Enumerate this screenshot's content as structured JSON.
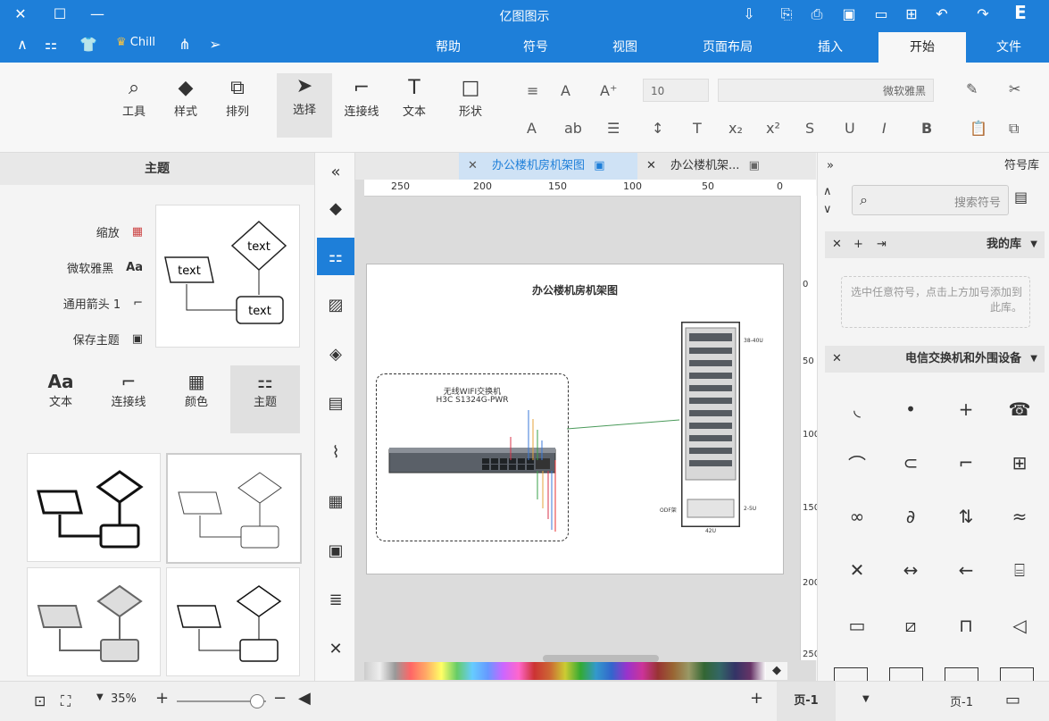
{
  "window": {
    "title": "亿图图示"
  },
  "menu_tabs": [
    "文件",
    "开始",
    "插入",
    "页面布局",
    "视图",
    "符号",
    "帮助"
  ],
  "active_tab": "开始",
  "user": {
    "name": "Chill"
  },
  "ribbon": {
    "font_name": "微软雅黑",
    "font_size": "10",
    "tools": {
      "shape": "形状",
      "text": "文本",
      "connector": "连接线",
      "select": "选择",
      "arrange": "排列",
      "style": "样式",
      "tools": "工具"
    }
  },
  "symbol_library": {
    "title": "符号库",
    "search_placeholder": "搜索符号",
    "my_library": "我的库",
    "my_library_hint": "选中任意符号，点击上方加号添加到此库。",
    "category": "电信交换机和外围设备"
  },
  "doc_tabs": [
    {
      "label": "办公楼机架...",
      "active": false
    },
    {
      "label": "办公楼机房机架图",
      "active": true
    }
  ],
  "ruler": {
    "top_ticks": [
      "0",
      "50",
      "100",
      "150",
      "200",
      "250"
    ],
    "side_ticks": [
      "0",
      "50",
      "100",
      "150",
      "200",
      "250"
    ]
  },
  "canvas": {
    "diagram_title": "办公楼机房机架图",
    "switch_title_1": "无线WIFI交换机",
    "switch_title_2": "H3C S1324G-PWR",
    "rack_bottom": "42U",
    "rack_label_left": "2-5U",
    "rack_label_right": "ODF架",
    "rack_top_label": "38-40U"
  },
  "theme_panel": {
    "title": "主题",
    "options": [
      "缩放",
      "微软雅黑",
      "通用箭头 1",
      "保存主题"
    ],
    "tabs": [
      "主题",
      "颜色",
      "连接线",
      "文本"
    ],
    "preview_texts": [
      "text",
      "text",
      "text"
    ]
  },
  "statusbar": {
    "page_selector": "页-1",
    "page_tab": "页-1",
    "zoom": "35%"
  },
  "colors": {
    "accent": "#1e7fd9",
    "titlebar": "#1e7fd9"
  }
}
